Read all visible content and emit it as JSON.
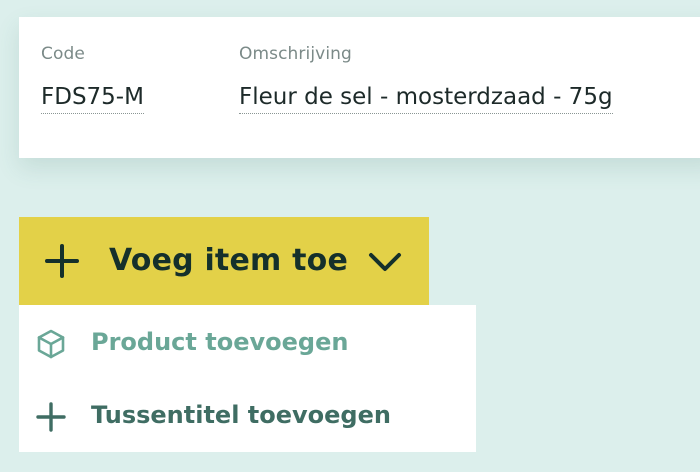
{
  "form": {
    "code": {
      "label": "Code",
      "value": "FDS75-M"
    },
    "description": {
      "label": "Omschrijving",
      "value": "Fleur de sel - mosterdzaad - 75g"
    }
  },
  "add_button": {
    "label": "Voeg item toe",
    "icon": "plus-icon",
    "chevron_icon": "chevron-down-icon",
    "color": "#e3d148"
  },
  "dropdown": {
    "items": [
      {
        "label": "Product toevoegen",
        "icon": "box-icon",
        "color": "#6aa797"
      },
      {
        "label": "Tussentitel toevoegen",
        "icon": "plus-icon",
        "color": "#3f6d63"
      }
    ]
  }
}
